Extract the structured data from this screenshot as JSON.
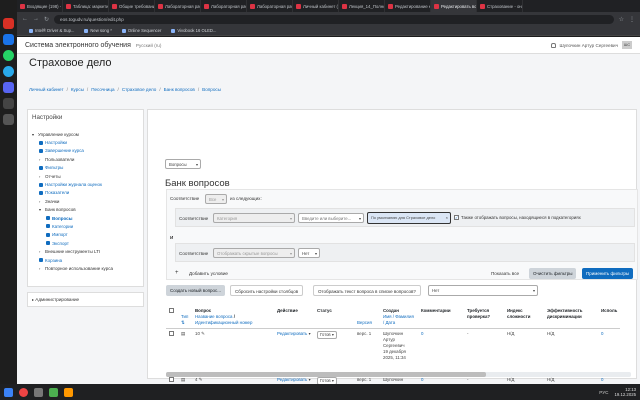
{
  "browser": {
    "tabs": [
      {
        "label": "Входящие (198) - Эл"
      },
      {
        "label": "Таблица: маркетин"
      },
      {
        "label": "Общие требования"
      },
      {
        "label": "Лабораторная рабо"
      },
      {
        "label": "Лабораторная рабо"
      },
      {
        "label": "Лабораторная рабо"
      },
      {
        "label": "Личный кабинет (НС"
      },
      {
        "label": "Лекция_14_Полное"
      },
      {
        "label": "Редактирование ку"
      },
      {
        "label": "Редактировать вопрос"
      },
      {
        "label": "Страхование - онл"
      }
    ],
    "url": "eos.togudv.ru/question/edit.php",
    "bookmarks": [
      {
        "label": "Intel® Driver & Sup..."
      },
      {
        "label": "New song *"
      },
      {
        "label": "Online Sequencer"
      },
      {
        "label": "Vivobook 16 OLED..."
      }
    ]
  },
  "site": {
    "name": "Система электронного обучения",
    "language": "Русский (ru)",
    "user_name": "Шупочкин Артур Сергеевич",
    "avatar_initials": "ШС"
  },
  "page_title": "Страховое дело",
  "breadcrumb": [
    "Личный кабинет",
    "Курсы",
    "Песочница",
    "Страховое дело",
    "Банк вопросов",
    "Вопросы"
  ],
  "sidebar": {
    "title": "Настройки",
    "items": [
      {
        "label": "Управление курсом",
        "kind": "header"
      },
      {
        "label": "Настройки",
        "kind": "link"
      },
      {
        "label": "Завершение курса",
        "kind": "link"
      },
      {
        "label": "Пользователи",
        "kind": "folder"
      },
      {
        "label": "Фильтры",
        "kind": "link"
      },
      {
        "label": "Отчеты",
        "kind": "folder"
      },
      {
        "label": "Настройки журнала оценок",
        "kind": "link"
      },
      {
        "label": "Показатели",
        "kind": "link"
      },
      {
        "label": "Значки",
        "kind": "folder"
      },
      {
        "label": "Банк вопросов",
        "kind": "open"
      },
      {
        "label": "Вопросы",
        "kind": "active"
      },
      {
        "label": "Категории",
        "kind": "link"
      },
      {
        "label": "Импорт",
        "kind": "link"
      },
      {
        "label": "Экспорт",
        "kind": "link"
      },
      {
        "label": "Внешние инструменты LTI",
        "kind": "folder"
      },
      {
        "label": "Корзина",
        "kind": "link"
      },
      {
        "label": "Повторное использование курса",
        "kind": "folder"
      }
    ],
    "admin_label": "Администрирование"
  },
  "main": {
    "mode_select": "Вопросы",
    "heading": "Банк вопросов",
    "match_label": "Соответствие",
    "match_value": "Все",
    "match_suffix": "из следующих:",
    "cond1": {
      "label": "Соответствие",
      "type": "Категория",
      "category_placeholder": "Введите или выберите...",
      "category_value": "По умолчанию для Страховое дело",
      "subcat_label": "Также отображать вопросы, находящиеся в подкатегориях"
    },
    "and_label": "И",
    "cond2": {
      "label": "Соответствие",
      "type": "Отображать скрытые вопросы",
      "value": "Нет"
    },
    "add_condition": "Добавить условие",
    "show_more": "Показать все",
    "clear_filters": "Очистить фильтры",
    "apply_filters": "Применить фильтры",
    "create_question": "Создать новый вопрос...",
    "reset_columns": "Сбросить настройки столбцов",
    "show_text": "Отображать текст вопроса в списке вопросов?",
    "show_text_value": "Нет",
    "columns": {
      "type": "Тип",
      "question": "Вопрос",
      "question_name": "Название вопроса",
      "question_id": "Идентификационный номер",
      "actions": "Действие",
      "status": "Статус",
      "version": "Версия",
      "created_by": "Создан",
      "created_by_parts": "Имя / Фамилия / Дата",
      "comments": "Комментарии",
      "needs_check": "Требуется проверка?",
      "difficulty": "Индекс сложности",
      "discrimination": "Эффективность дискриминации",
      "usage": "Исполь"
    },
    "rows": [
      {
        "id_text": "10",
        "edit": "Редактировать",
        "status": "Готов",
        "version": "верс. 1",
        "author": "Шупочкин Артур Сергеевич",
        "date": "19 декабря 2025, 11:34",
        "comments": "0",
        "needs_check": "-",
        "difficulty": "Н/Д",
        "discrimination": "Н/Д",
        "usage": "0"
      },
      {
        "id_text": "4",
        "edit": "Редактировать",
        "status": "Готов",
        "version": "верс. 1",
        "author": "Шупочкин Артур Сергеевич",
        "date": "",
        "comments": "0",
        "needs_check": "-",
        "difficulty": "Н/Д",
        "discrimination": "Н/Д",
        "usage": "0"
      }
    ]
  },
  "taskbar": {
    "time": "12:13",
    "date": "19.12.2025",
    "lang": "РУС"
  },
  "colors": {
    "accent": "#0f6cbf",
    "chrome_dark": "#202124",
    "page_bg": "#f4f5f7"
  }
}
